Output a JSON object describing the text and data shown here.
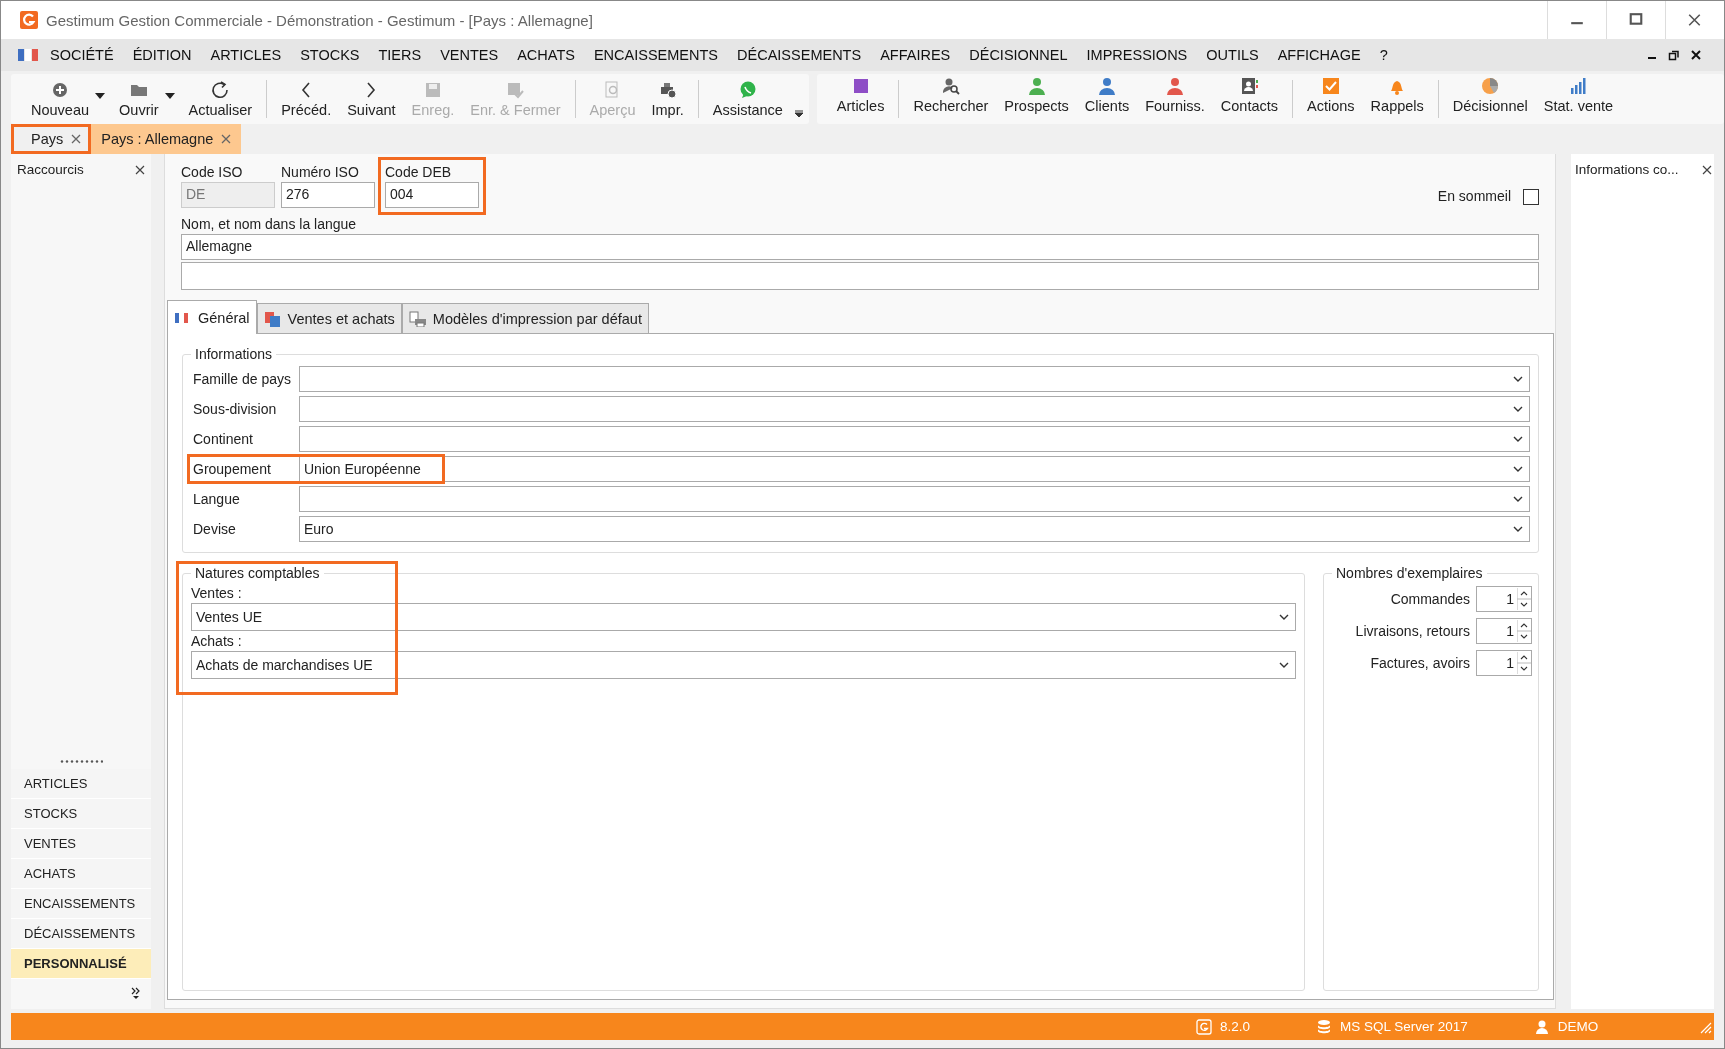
{
  "window": {
    "title": "Gestimum Gestion Commerciale - Démonstration - Gestimum - [Pays : Allemagne]"
  },
  "menu": [
    "SOCIÉTÉ",
    "ÉDITION",
    "ARTICLES",
    "STOCKS",
    "TIERS",
    "VENTES",
    "ACHATS",
    "ENCAISSEMENTS",
    "DÉCAISSEMENTS",
    "AFFAIRES",
    "DÉCISIONNEL",
    "IMPRESSIONS",
    "OUTILS",
    "AFFICHAGE",
    "?"
  ],
  "toolbar": [
    [
      {
        "label": "Nouveau",
        "kind": "plus",
        "disabled": false,
        "dropdown": true
      },
      {
        "label": "Ouvrir",
        "kind": "folder",
        "disabled": false,
        "dropdown": true
      },
      {
        "label": "Actualiser",
        "kind": "refresh",
        "disabled": false,
        "dropdown": false
      }
    ],
    [
      {
        "label": "Précéd.",
        "kind": "prev",
        "disabled": false,
        "dropdown": false
      },
      {
        "label": "Suivant",
        "kind": "next",
        "disabled": false,
        "dropdown": false
      },
      {
        "label": "Enreg.",
        "kind": "save",
        "disabled": true,
        "dropdown": false
      },
      {
        "label": "Enr. & Fermer",
        "kind": "save-check",
        "disabled": true,
        "dropdown": false
      }
    ],
    [
      {
        "label": "Aperçu",
        "kind": "preview",
        "disabled": true,
        "dropdown": false
      },
      {
        "label": "Impr.",
        "kind": "print",
        "disabled": false,
        "dropdown": false
      }
    ],
    [
      {
        "label": "Assistance",
        "kind": "chat",
        "disabled": false,
        "dropdown": false
      }
    ]
  ],
  "toolbar2": [
    [
      {
        "label": "Articles",
        "kind": "square",
        "disabled": false
      }
    ],
    [
      {
        "label": "Rechercher",
        "kind": "search-person",
        "disabled": false
      },
      {
        "label": "Prospects",
        "kind": "person",
        "color": "#4caf50",
        "disabled": false
      },
      {
        "label": "Clients",
        "kind": "person",
        "color": "#3f7cc7",
        "disabled": false
      },
      {
        "label": "Fourniss.",
        "kind": "person",
        "color": "#e2574c",
        "disabled": false
      },
      {
        "label": "Contacts",
        "kind": "contact",
        "disabled": false
      }
    ],
    [
      {
        "label": "Actions",
        "kind": "check-box",
        "disabled": false
      },
      {
        "label": "Rappels",
        "kind": "bell",
        "disabled": false
      }
    ],
    [
      {
        "label": "Décisionnel",
        "kind": "pie",
        "disabled": false
      },
      {
        "label": "Stat. vente",
        "kind": "bars",
        "disabled": false
      }
    ]
  ],
  "doc_tabs": [
    {
      "label": "Pays",
      "selected": false,
      "highlighted": true
    },
    {
      "label": "Pays : Allemagne",
      "selected": true,
      "highlighted": false
    }
  ],
  "sidebar": {
    "title": "Raccourcis",
    "items": [
      {
        "label": "ARTICLES",
        "selected": false
      },
      {
        "label": "STOCKS",
        "selected": false
      },
      {
        "label": "VENTES",
        "selected": false
      },
      {
        "label": "ACHATS",
        "selected": false
      },
      {
        "label": "ENCAISSEMENTS",
        "selected": false
      },
      {
        "label": "DÉCAISSEMENTS",
        "selected": false
      },
      {
        "label": "PERSONNALISÉ",
        "selected": true
      }
    ]
  },
  "form": {
    "codes": [
      {
        "label": "Code ISO",
        "value": "DE",
        "disabled": true
      },
      {
        "label": "Numéro ISO",
        "value": "276",
        "disabled": false
      },
      {
        "label": "Code DEB",
        "value": "004",
        "disabled": false,
        "highlighted": true
      }
    ],
    "en_sommeil": {
      "label": "En sommeil",
      "checked": false
    },
    "nom": {
      "label": "Nom, et nom dans la langue",
      "value": "Allemagne"
    },
    "tabs": [
      {
        "label": "Général",
        "kind": "flag",
        "selected": true
      },
      {
        "label": "Ventes et achats",
        "kind": "docs",
        "selected": false
      },
      {
        "label": "Modèles d'impression par défaut",
        "kind": "printer",
        "selected": false
      }
    ],
    "informations": {
      "title": "Informations",
      "rows": [
        {
          "label": "Famille de pays"
        },
        {
          "label": "Sous-division"
        },
        {
          "label": "Continent"
        },
        {
          "label": "Groupement",
          "value": "Union Européenne",
          "highlighted": true
        },
        {
          "label": "Langue"
        },
        {
          "label": "Devise",
          "value": "Euro"
        }
      ]
    },
    "natures": {
      "title": "Natures comptables",
      "highlighted": true,
      "rows": [
        {
          "label": "Ventes :",
          "value": "Ventes UE"
        },
        {
          "label": "Achats :",
          "value": "Achats de marchandises UE"
        }
      ]
    },
    "exemplaires": {
      "title": "Nombres d'exemplaires",
      "rows": [
        {
          "label": "Commandes",
          "value": "1"
        },
        {
          "label": "Livraisons, retours",
          "value": "1"
        },
        {
          "label": "Factures, avoirs",
          "value": "1"
        }
      ]
    }
  },
  "right_panel": {
    "title": "Informations co..."
  },
  "status_bar": {
    "version": "8.2.0",
    "database": "MS SQL Server 2017",
    "user": "DEMO"
  }
}
